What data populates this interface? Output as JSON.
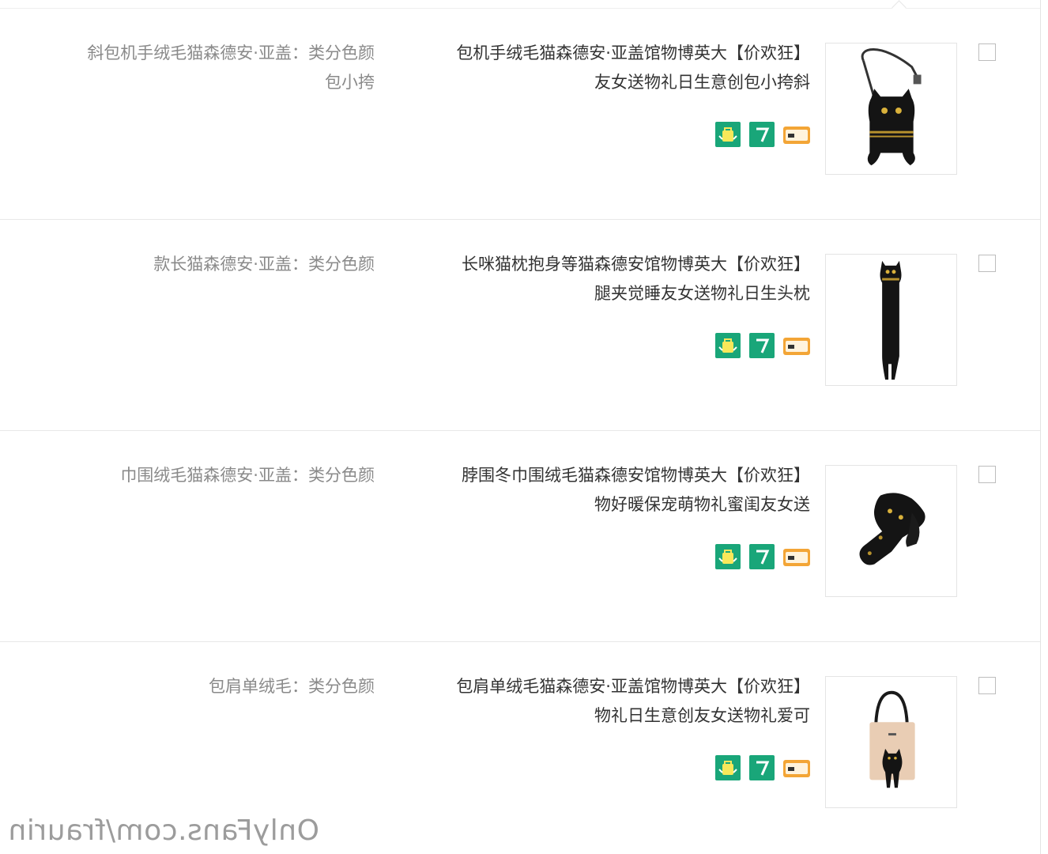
{
  "items": [
    {
      "title": "【狂欢价】大英博物馆盖亚·安德森猫毛绒手机包斜挎小包创意生日礼物送女友",
      "sku": "颜色分类：盖亚·安德森猫毛绒手机包斜挎小包",
      "image_icon": "cat-crossbody-bag",
      "checked": false
    },
    {
      "title": "【狂欢价】大英博物馆安德森猫等身抱枕猫咪长枕头生日礼物送女友睡觉夹腿",
      "sku": "颜色分类：盖亚·安德森猫长款",
      "image_icon": "cat-long-pillow",
      "checked": false
    },
    {
      "title": "【狂欢价】大英博物馆安德森猫毛绒围巾冬围脖送女友闺蜜礼物萌宠保暖好物",
      "sku": "颜色分类：盖亚·安德森猫毛绒围巾",
      "image_icon": "cat-scarf",
      "checked": false
    },
    {
      "title": "【狂欢价】大英博物馆盖亚·安德森猫毛绒单肩包可爱礼物送女友创意生日礼物",
      "sku": "颜色分类：毛绒单肩包",
      "image_icon": "cat-tote-bag",
      "checked": false
    }
  ],
  "service_icons": [
    "shopping-bag-icon",
    "seven-day-return-icon",
    "credit-card-icon"
  ],
  "colors": {
    "service_green": "#19a679",
    "card_orange": "#f3a536"
  },
  "watermark": "OnlyFans.com/fraurin"
}
